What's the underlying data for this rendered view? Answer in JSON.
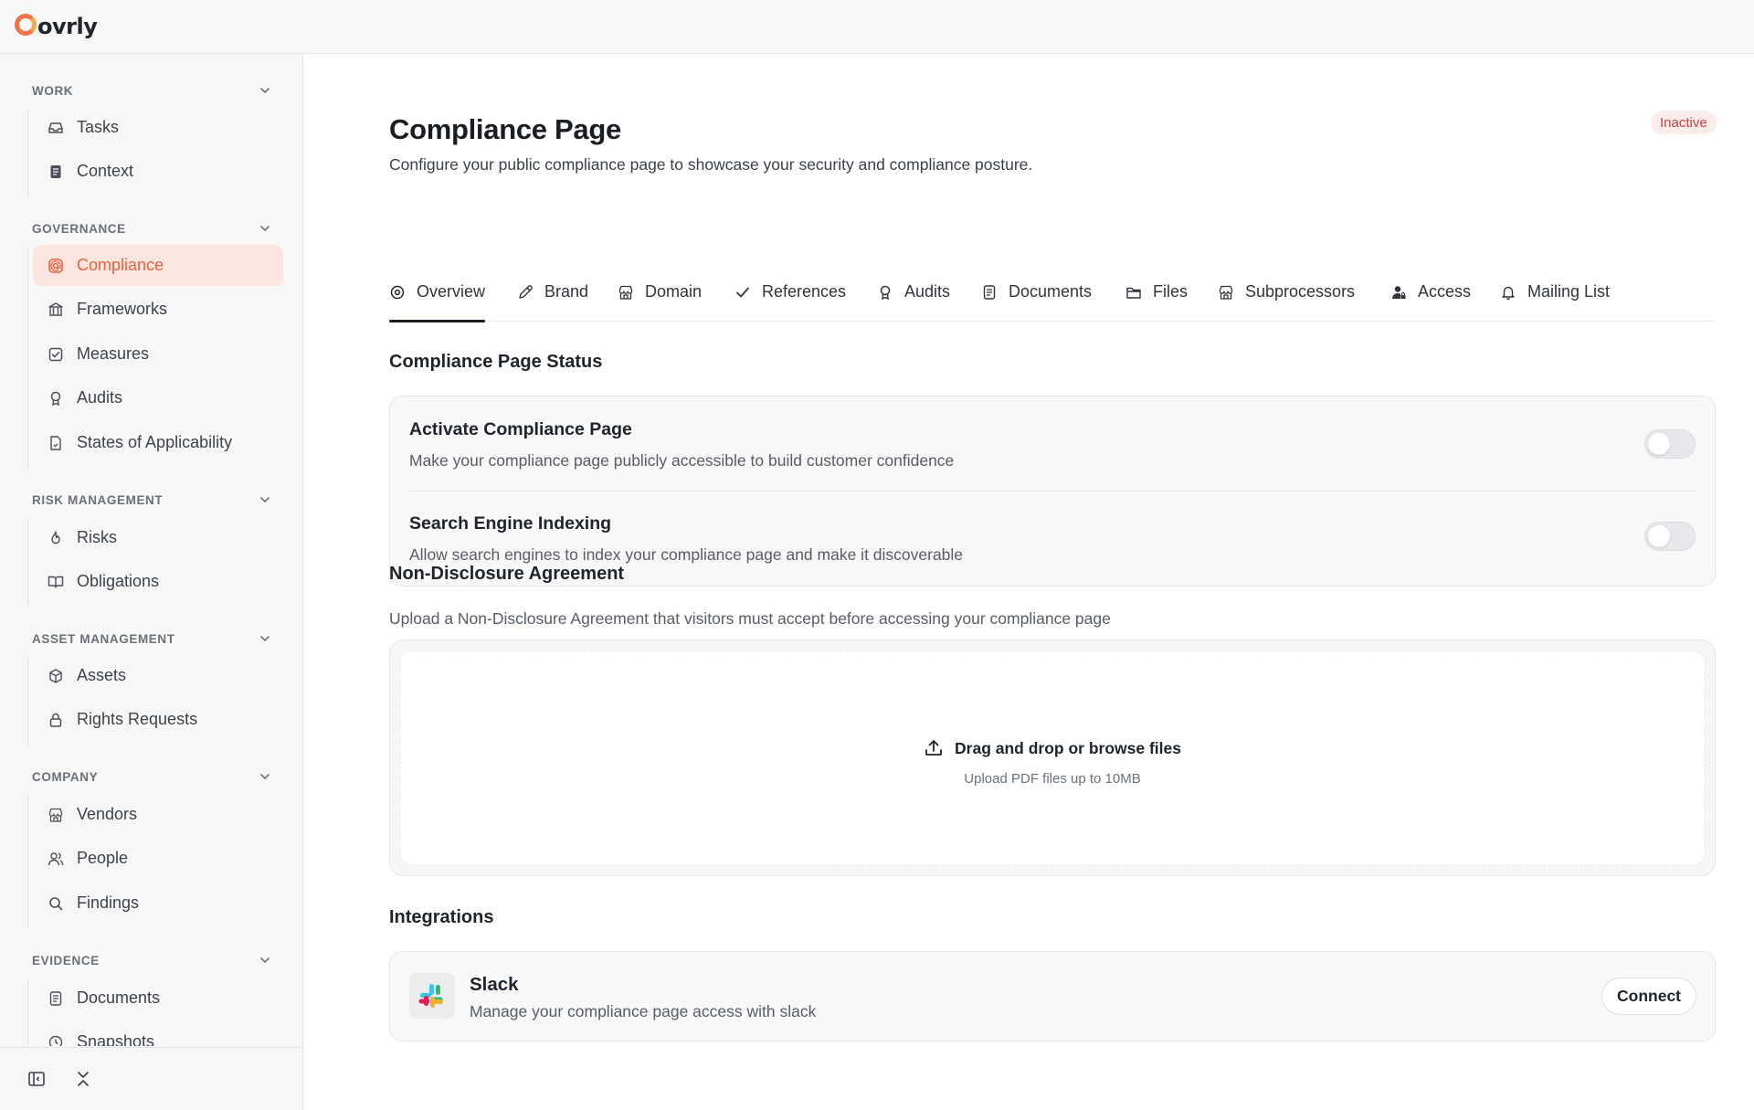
{
  "app": {
    "logo_text": "ovrly"
  },
  "sidebar": {
    "groups": [
      {
        "label": "WORK",
        "items": [
          {
            "label": "Tasks",
            "icon": "inbox-icon"
          },
          {
            "label": "Context",
            "icon": "document-icon"
          }
        ]
      },
      {
        "label": "GOVERNANCE",
        "items": [
          {
            "label": "Compliance",
            "icon": "at-badge-icon",
            "active": true
          },
          {
            "label": "Frameworks",
            "icon": "landmark-icon"
          },
          {
            "label": "Measures",
            "icon": "checkbox-icon"
          },
          {
            "label": "Audits",
            "icon": "award-icon"
          },
          {
            "label": "States of Applicability",
            "icon": "file-check-icon"
          }
        ]
      },
      {
        "label": "RISK MANAGEMENT",
        "items": [
          {
            "label": "Risks",
            "icon": "fire-icon"
          },
          {
            "label": "Obligations",
            "icon": "book-open-icon"
          }
        ]
      },
      {
        "label": "ASSET MANAGEMENT",
        "items": [
          {
            "label": "Assets",
            "icon": "cube-icon"
          },
          {
            "label": "Rights Requests",
            "icon": "lock-icon"
          }
        ]
      },
      {
        "label": "COMPANY",
        "items": [
          {
            "label": "Vendors",
            "icon": "storefront-icon"
          },
          {
            "label": "People",
            "icon": "users-icon"
          },
          {
            "label": "Findings",
            "icon": "search-icon"
          }
        ]
      },
      {
        "label": "EVIDENCE",
        "items": [
          {
            "label": "Documents",
            "icon": "document-icon"
          },
          {
            "label": "Snapshots",
            "icon": "clock-icon"
          }
        ]
      }
    ]
  },
  "header": {
    "title": "Compliance Page",
    "subtitle": "Configure your public compliance page to showcase your security and compliance posture.",
    "status_badge": "Inactive",
    "status_color": "#d63c3c"
  },
  "tabs": [
    {
      "label": "Overview",
      "icon": "target-icon",
      "active": true
    },
    {
      "label": "Brand",
      "icon": "pencil-icon"
    },
    {
      "label": "Domain",
      "icon": "storefront-icon"
    },
    {
      "label": "References",
      "icon": "check-icon"
    },
    {
      "label": "Audits",
      "icon": "award-icon"
    },
    {
      "label": "Documents",
      "icon": "document-icon"
    },
    {
      "label": "Files",
      "icon": "folder-icon"
    },
    {
      "label": "Subprocessors",
      "icon": "storefront-icon"
    },
    {
      "label": "Access",
      "icon": "user-lock-icon"
    },
    {
      "label": "Mailing List",
      "icon": "bell-icon"
    }
  ],
  "status_section": {
    "title": "Compliance Page Status",
    "rows": [
      {
        "title": "Activate Compliance Page",
        "description": "Make your compliance page publicly accessible to build customer confidence",
        "enabled": false
      },
      {
        "title": "Search Engine Indexing",
        "description": "Allow search engines to index your compliance page and make it discoverable",
        "enabled": false
      }
    ]
  },
  "nda_section": {
    "title": "Non-Disclosure Agreement",
    "description": "Upload a Non-Disclosure Agreement that visitors must accept before accessing your compliance page",
    "dropzone_label": "Drag and drop or browse files",
    "dropzone_hint": "Upload PDF files up to 10MB"
  },
  "integrations": {
    "title": "Integrations",
    "items": [
      {
        "name": "Slack",
        "description": "Manage your compliance page access with slack",
        "action": "Connect",
        "icon": "slack-icon"
      }
    ]
  },
  "colors": {
    "accent": "#e8623c",
    "accent_bg": "#fbe6df"
  }
}
